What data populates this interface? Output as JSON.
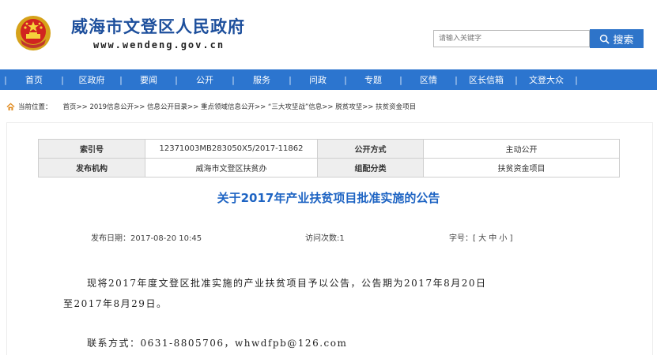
{
  "header": {
    "site_title": "威海市文登区人民政府",
    "site_url": "www.wendeng.gov.cn",
    "search_placeholder": "请输入关键字",
    "search_label": "搜索"
  },
  "nav": {
    "items": [
      "首页",
      "区政府",
      "要闻",
      "公开",
      "服务",
      "问政",
      "专题",
      "区情",
      "区长信箱",
      "文登大众"
    ]
  },
  "breadcrumb": {
    "label": "当前位置：",
    "path": "首页>> 2019信息公开>> 信息公开目录>> 重点领域信息公开>> “三大攻坚战”信息>> 脱贫攻坚>> 扶贫资金项目"
  },
  "meta": {
    "index_key": "索引号",
    "index_value": "12371003MB283050X5/2017-11862",
    "method_key": "公开方式",
    "method_value": "主动公开",
    "org_key": "发布机构",
    "org_value": "威海市文登区扶贫办",
    "category_key": "组配分类",
    "category_value": "扶贫资金项目"
  },
  "article": {
    "title": "关于2017年产业扶贫项目批准实施的公告",
    "publish_date": "发布日期：2017-08-20 10:45",
    "visits": "访问次数:1",
    "font_size": "字号：[ 大 中 小 ]",
    "para1_line1": "现将2017年度文登区批准实施的产业扶贫项目予以公告，公告期为2017年8月20日",
    "para1_line2": "至2017年8月29日。",
    "contact": "联系方式：0631-8805706，whwdfpb@126.com"
  },
  "colors": {
    "nav_bg": "#2c75cf",
    "title_blue": "#1e64c3",
    "search_button": "#2e74c9"
  }
}
